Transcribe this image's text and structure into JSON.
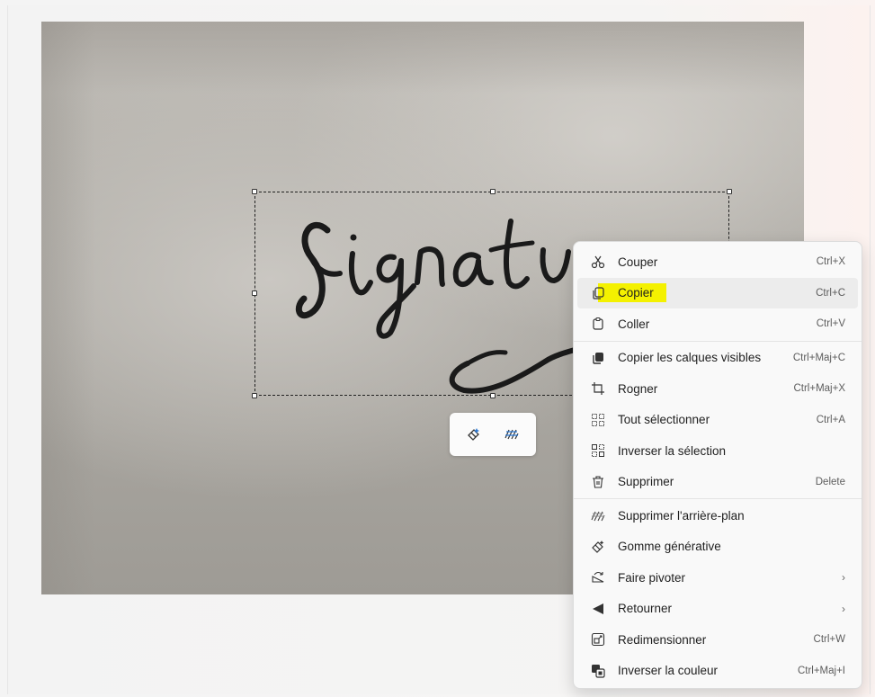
{
  "canvas": {
    "photo_alt": "Signature"
  },
  "mini_toolbar": {
    "buttons": [
      "generative-erase-icon",
      "remove-background-icon"
    ]
  },
  "context_menu": {
    "items": [
      {
        "icon": "scissors-icon",
        "label": "Couper",
        "shortcut": "Ctrl+X"
      },
      {
        "icon": "copy-icon",
        "label": "Copier",
        "shortcut": "Ctrl+C",
        "highlighted": true
      },
      {
        "icon": "paste-icon",
        "label": "Coller",
        "shortcut": "Ctrl+V"
      },
      {
        "icon": "copy-layers-icon",
        "label": "Copier les calques visibles",
        "shortcut": "Ctrl+Maj+C"
      },
      {
        "icon": "crop-icon",
        "label": "Rogner",
        "shortcut": "Ctrl+Maj+X"
      },
      {
        "icon": "select-all-icon",
        "label": "Tout sélectionner",
        "shortcut": "Ctrl+A"
      },
      {
        "icon": "invert-selection-icon",
        "label": "Inverser la sélection",
        "shortcut": ""
      },
      {
        "icon": "trash-icon",
        "label": "Supprimer",
        "shortcut": "Delete"
      },
      {
        "icon": "remove-background-icon",
        "label": "Supprimer l'arrière-plan",
        "shortcut": ""
      },
      {
        "icon": "generative-erase-icon",
        "label": "Gomme générative",
        "shortcut": ""
      },
      {
        "icon": "rotate-icon",
        "label": "Faire pivoter",
        "submenu": "›"
      },
      {
        "icon": "flip-icon",
        "label": "Retourner",
        "submenu": "›"
      },
      {
        "icon": "resize-icon",
        "label": "Redimensionner",
        "shortcut": "Ctrl+W"
      },
      {
        "icon": "invert-color-icon",
        "label": "Inverser la couleur",
        "shortcut": "Ctrl+Maj+I"
      }
    ]
  }
}
